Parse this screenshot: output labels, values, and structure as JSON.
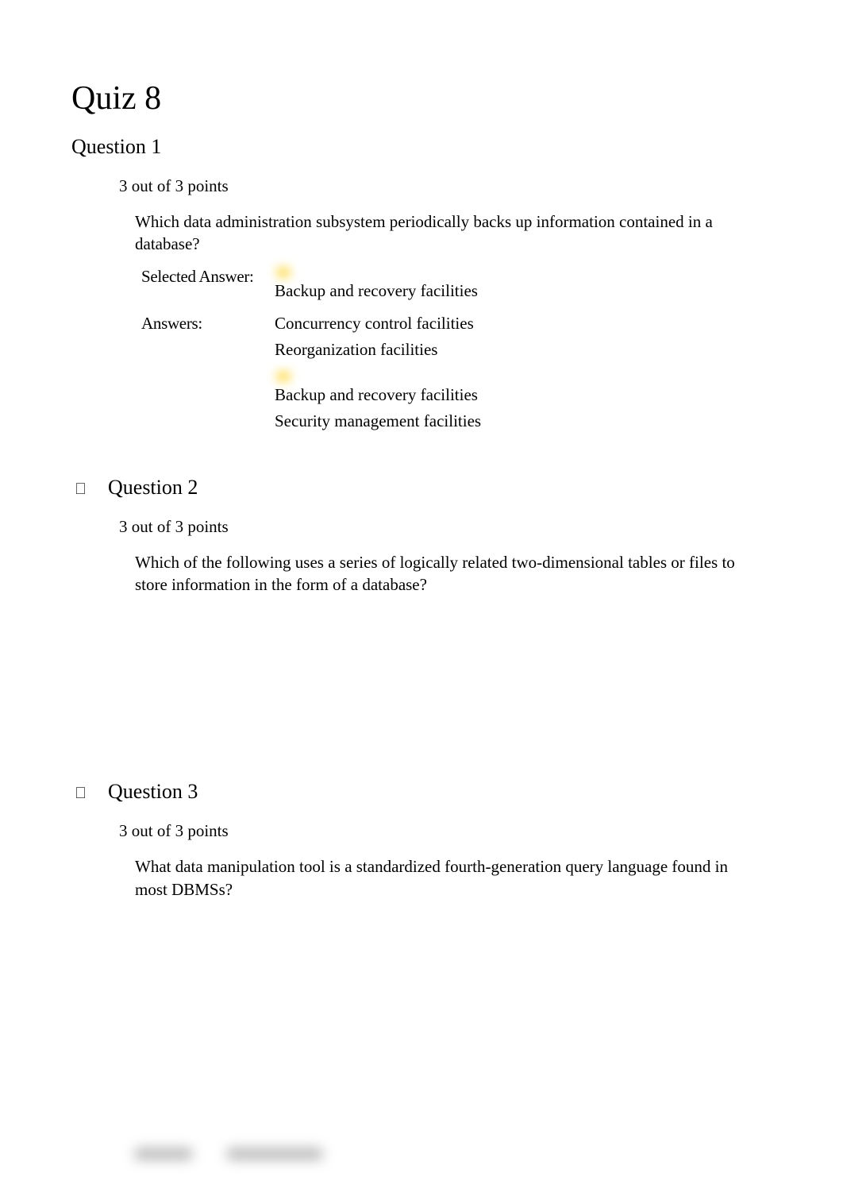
{
  "title": "Quiz 8",
  "questions": [
    {
      "heading": "Question 1",
      "points": "3 out of 3 points",
      "prompt": "Which data administration subsystem periodically backs up information contained in a database?",
      "selected_label": "Selected Answer:",
      "selected_value": "Backup and recovery facilities",
      "answers_label": "Answers:",
      "answers": [
        "Concurrency control facilities",
        "Reorganization facilities",
        "Backup and recovery facilities",
        "Security management facilities"
      ]
    },
    {
      "heading": "Question 2",
      "points": "3 out of 3 points",
      "prompt": "Which of the following uses a series of logically related two-dimensional tables or files to store information in the form of a database?"
    },
    {
      "heading": "Question 3",
      "points": "3 out of 3 points",
      "prompt": "What data manipulation tool is a standardized fourth-generation query language found in most DBMSs?"
    }
  ]
}
